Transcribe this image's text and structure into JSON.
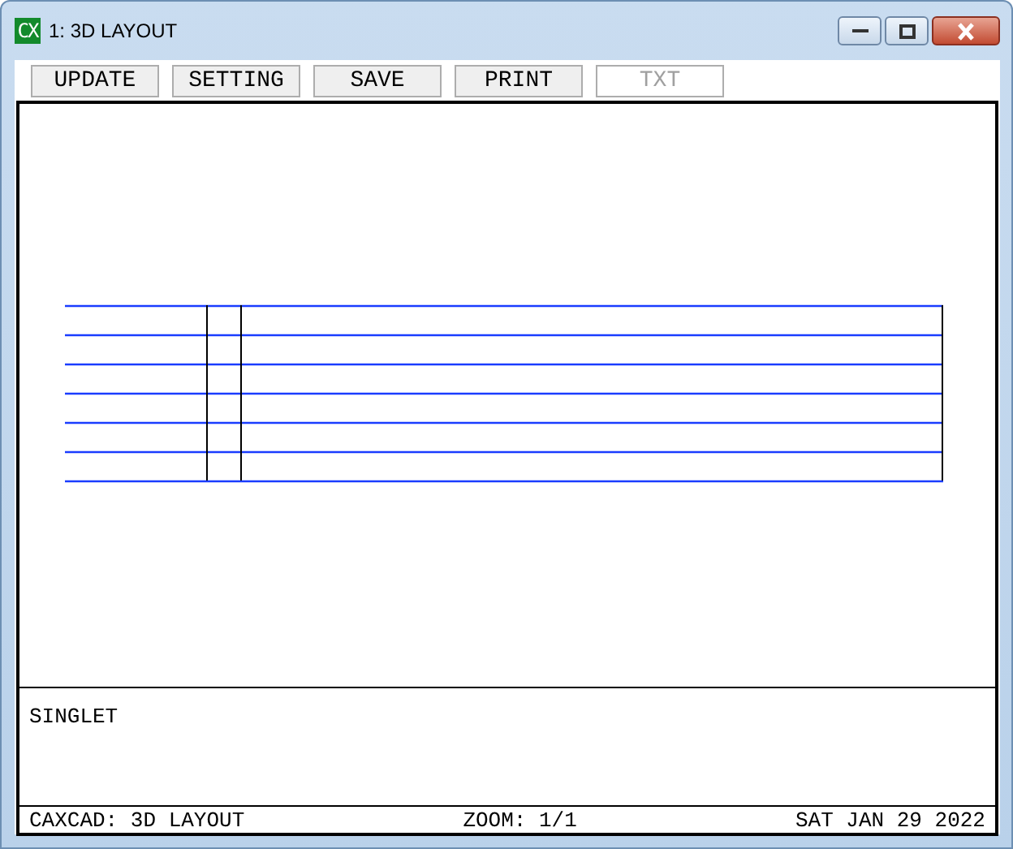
{
  "window": {
    "title": "1: 3D LAYOUT",
    "icon_text": "CX"
  },
  "toolbar": [
    {
      "label": "UPDATE",
      "disabled": false
    },
    {
      "label": "SETTING",
      "disabled": false
    },
    {
      "label": "SAVE",
      "disabled": false
    },
    {
      "label": "PRINT",
      "disabled": false
    },
    {
      "label": "TXT",
      "disabled": true
    }
  ],
  "message": "SINGLET",
  "status_bar": {
    "left": "CAXCAD: 3D LAYOUT",
    "center": "ZOOM: 1/1",
    "right": "SAT JAN 29 2022"
  }
}
